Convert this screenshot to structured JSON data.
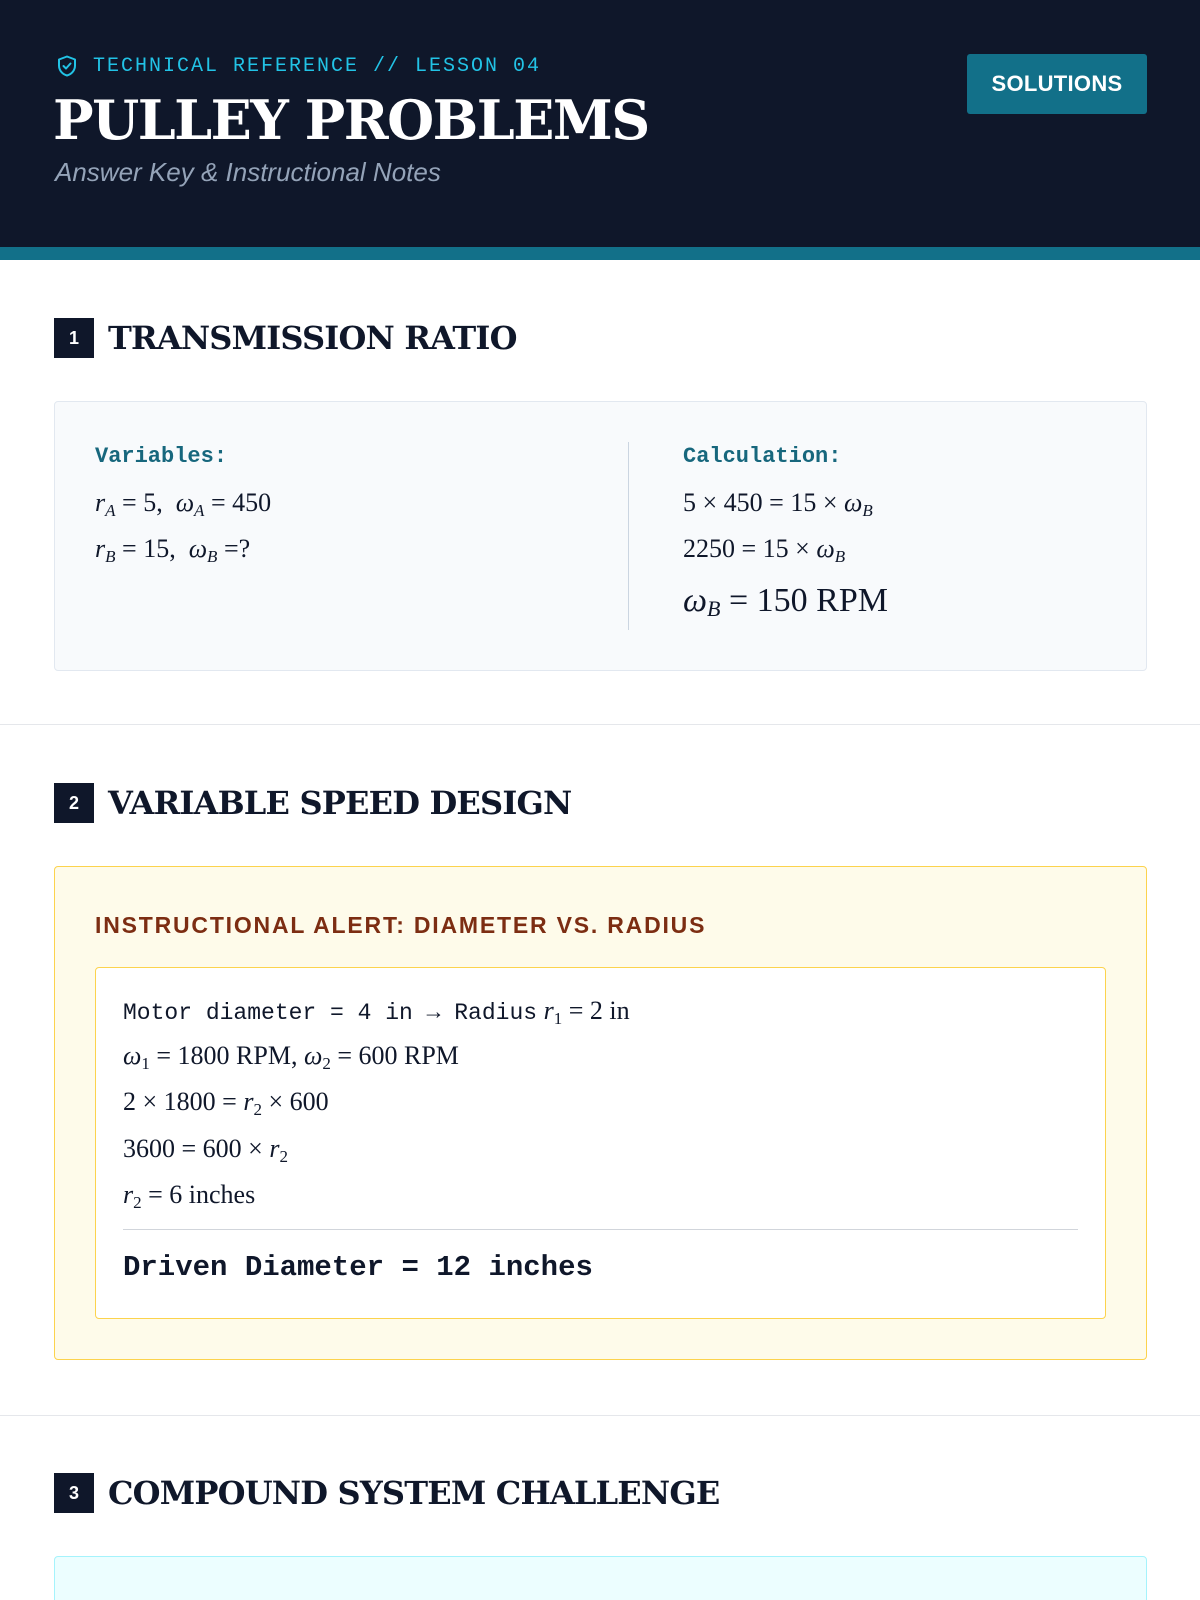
{
  "header": {
    "eyebrow": "TECHNICAL REFERENCE // LESSON 04",
    "title": "PULLEY PROBLEMS",
    "subtitle": "Answer Key & Instructional Notes",
    "solutions_label": "SOLUTIONS",
    "icon": "shield-check-icon",
    "colors": {
      "background": "#0f172a",
      "accent": "#127089",
      "eyebrow": "#22c3e6"
    }
  },
  "sections": [
    {
      "number": "1",
      "title": "TRANSMISSION RATIO",
      "variables_label": "Variables:",
      "calculation_label": "Calculation:",
      "variables": {
        "rA": "5",
        "wA": "450",
        "rB": "15",
        "wB": "?"
      },
      "calculation": {
        "line1": {
          "a": "5",
          "b": "450",
          "c": "15"
        },
        "line2": {
          "a": "2250",
          "c": "15"
        },
        "result_value": "150",
        "result_unit": "RPM"
      }
    },
    {
      "number": "2",
      "title": "VARIABLE SPEED DESIGN",
      "alert_title": "INSTRUCTIONAL ALERT: DIAMETER VS. RADIUS",
      "lines": {
        "motor_prefix": "Motor diameter = 4 in → Radius",
        "r1": "2 in",
        "w1": "1800 RPM",
        "w2": "600 RPM",
        "l3_a": "2",
        "l3_b": "1800",
        "l3_c": "600",
        "l4_a": "3600",
        "l4_b": "600",
        "l5_val": "6 inches"
      },
      "result": "Driven Diameter = 12 inches"
    },
    {
      "number": "3",
      "title": "COMPOUND SYSTEM CHALLENGE"
    }
  ]
}
